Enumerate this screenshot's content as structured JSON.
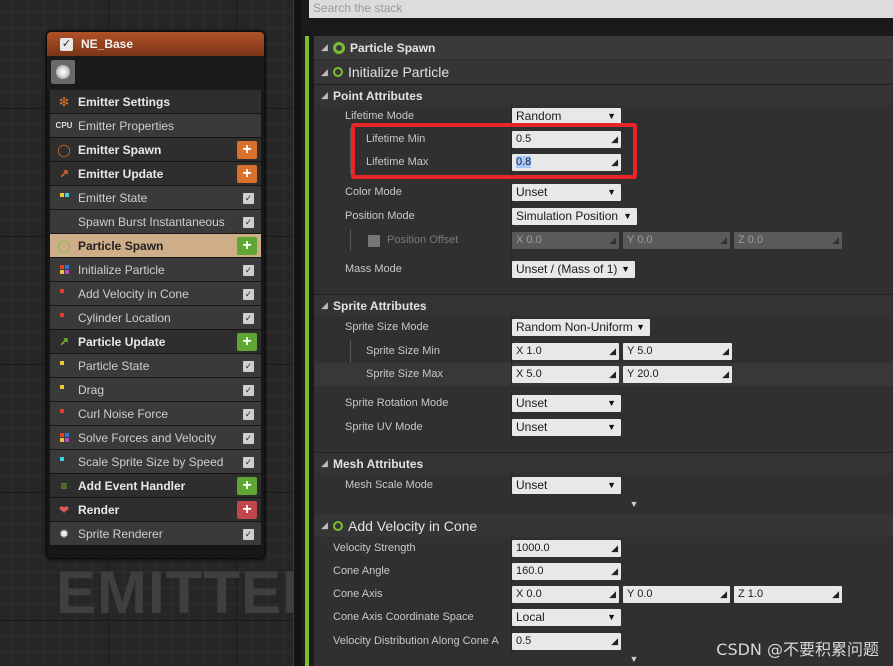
{
  "node": {
    "title": "NE_Base",
    "watermark": "EMITTER",
    "rows": [
      {
        "kind": "sec",
        "icon": "emitter-settings-icon",
        "glyph": "❇",
        "color": "#e0702a",
        "label": "Emitter Settings"
      },
      {
        "kind": "item",
        "icon": "cpu-icon",
        "glyph": "CPU",
        "color": "#ddd",
        "label": "Emitter Properties"
      },
      {
        "kind": "sec",
        "icon": "emitter-spawn-icon",
        "glyph": "◯",
        "color": "#e0702a",
        "label": "Emitter Spawn",
        "plus": "orange"
      },
      {
        "kind": "sec",
        "icon": "emitter-update-icon",
        "glyph": "↗",
        "color": "#e0702a",
        "label": "Emitter Update",
        "plus": "orange"
      },
      {
        "kind": "item",
        "icon": "module-dots-icon",
        "dots": [
          "#e8c63a",
          "#3fd0e0",
          "",
          ""
        ],
        "label": "Emitter State",
        "check": true
      },
      {
        "kind": "item",
        "icon": "module-dots-icon",
        "dots": [
          "",
          "",
          "",
          ""
        ],
        "label": "Spawn Burst Instantaneous",
        "check": true
      },
      {
        "kind": "sel",
        "icon": "particle-spawn-icon",
        "glyph": "◯",
        "color": "#7bbf30",
        "label": "Particle Spawn",
        "plus": "green"
      },
      {
        "kind": "item",
        "icon": "module-dots-icon",
        "dots": [
          "#e0402a",
          "#3070e0",
          "#e8c63a",
          "#c040c0"
        ],
        "label": "Initialize Particle",
        "check": true
      },
      {
        "kind": "item",
        "icon": "module-dots-icon",
        "dots": [
          "#e0402a",
          "",
          "",
          ""
        ],
        "label": "Add Velocity in Cone",
        "check": true
      },
      {
        "kind": "item",
        "icon": "module-dots-icon",
        "dots": [
          "#e0402a",
          "",
          "",
          ""
        ],
        "label": "Cylinder Location",
        "check": true
      },
      {
        "kind": "sec",
        "icon": "particle-update-icon",
        "glyph": "↗",
        "color": "#7bbf30",
        "label": "Particle Update",
        "plus": "green"
      },
      {
        "kind": "item",
        "icon": "module-dots-icon",
        "dots": [
          "#e8c63a",
          "",
          "",
          ""
        ],
        "label": "Particle State",
        "check": true
      },
      {
        "kind": "item",
        "icon": "module-dots-icon",
        "dots": [
          "#e8c63a",
          "",
          "",
          ""
        ],
        "label": "Drag",
        "check": true
      },
      {
        "kind": "item",
        "icon": "module-dots-icon",
        "dots": [
          "#e0402a",
          "",
          "",
          ""
        ],
        "label": "Curl Noise Force",
        "check": true
      },
      {
        "kind": "item",
        "icon": "module-dots-icon",
        "dots": [
          "#e0402a",
          "#3070e0",
          "#e8c63a",
          "#c040c0"
        ],
        "label": "Solve Forces and Velocity",
        "check": true
      },
      {
        "kind": "item",
        "icon": "module-dots-icon",
        "dots": [
          "#3fd0e0",
          "",
          "",
          ""
        ],
        "label": "Scale Sprite Size by Speed",
        "check": true
      },
      {
        "kind": "sec",
        "icon": "event-handler-icon",
        "glyph": "≡",
        "color": "#7bbf30",
        "label": "Add Event Handler",
        "plus": "green"
      },
      {
        "kind": "sec",
        "icon": "render-icon",
        "glyph": "❤",
        "color": "#e05a5a",
        "label": "Render",
        "plus": "red"
      },
      {
        "kind": "item",
        "icon": "sprite-burst-icon",
        "glyph": "✹",
        "color": "#eee",
        "label": "Sprite Renderer",
        "check": true
      }
    ]
  },
  "stack": {
    "search_placeholder": "Search the stack",
    "particle_spawn": "Particle Spawn",
    "initialize_particle": "Initialize Particle",
    "point_attributes": "Point Attributes",
    "lifetime_mode_label": "Lifetime Mode",
    "lifetime_mode_value": "Random",
    "lifetime_min_label": "Lifetime Min",
    "lifetime_min_value": "0.5",
    "lifetime_max_label": "Lifetime Max",
    "lifetime_max_value": "0.8",
    "color_mode_label": "Color Mode",
    "color_mode_value": "Unset",
    "position_mode_label": "Position Mode",
    "position_mode_value": "Simulation Position",
    "position_offset_label": "Position Offset",
    "position_offset": {
      "x": "X  0.0",
      "y": "Y  0.0",
      "z": "Z  0.0"
    },
    "mass_mode_label": "Mass Mode",
    "mass_mode_value": "Unset / (Mass of 1)",
    "sprite_attributes": "Sprite Attributes",
    "sprite_size_mode_label": "Sprite Size Mode",
    "sprite_size_mode_value": "Random Non-Uniform",
    "sprite_size_min_label": "Sprite Size Min",
    "sprite_size_min": {
      "x": "X  1.0",
      "y": "Y  5.0"
    },
    "sprite_size_max_label": "Sprite Size Max",
    "sprite_size_max": {
      "x": "X  5.0",
      "y": "Y  20.0"
    },
    "sprite_rotation_mode_label": "Sprite Rotation Mode",
    "sprite_rotation_mode_value": "Unset",
    "sprite_uv_mode_label": "Sprite UV Mode",
    "sprite_uv_mode_value": "Unset",
    "mesh_attributes": "Mesh Attributes",
    "mesh_scale_mode_label": "Mesh Scale Mode",
    "mesh_scale_mode_value": "Unset",
    "add_velocity_in_cone": "Add Velocity in Cone",
    "velocity_strength_label": "Velocity Strength",
    "velocity_strength_value": "1000.0",
    "cone_angle_label": "Cone Angle",
    "cone_angle_value": "160.0",
    "cone_axis_label": "Cone Axis",
    "cone_axis": {
      "x": "X  0.0",
      "y": "Y  0.0",
      "z": "Z  1.0"
    },
    "cone_axis_space_label": "Cone Axis Coordinate Space",
    "cone_axis_space_value": "Local",
    "velocity_distribution_label": "Velocity Distribution Along Cone A",
    "velocity_distribution_value": "0.5",
    "watermark": "CSDN @不要积累问题"
  },
  "colors": {
    "accent_green": "#7bbf30",
    "accent_orange": "#e0702a",
    "highlight_red": "#e8262a",
    "selected_row": "#cdae88"
  }
}
